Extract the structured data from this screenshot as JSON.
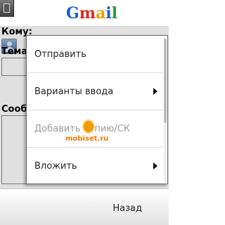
{
  "header": {
    "logo_letters": [
      "G",
      "m",
      "a",
      "i",
      "l"
    ],
    "back_icon": "exit-door-icon"
  },
  "compose": {
    "to_label": "Кому:",
    "subject_label": "Тема",
    "message_label": "Сообщ",
    "contact_icon": "contact-person-icon"
  },
  "menu": {
    "items": [
      {
        "label": "Отправить",
        "has_submenu": false,
        "enabled": true
      },
      {
        "label": "Варианты ввода",
        "has_submenu": true,
        "enabled": true
      },
      {
        "label": "Добавить копию/СК",
        "has_submenu": false,
        "enabled": false
      },
      {
        "label": "Вложить",
        "has_submenu": true,
        "enabled": true
      }
    ]
  },
  "watermark": {
    "text": "mobiset.ru"
  },
  "softkeys": {
    "right_label": "Назад"
  },
  "colors": {
    "logo_blue": "#1e5ec9",
    "logo_red": "#d62d20",
    "logo_yellow": "#e4a100",
    "logo_green": "#2c9a36",
    "disabled_text": "#9a9a9a",
    "watermark_orange": "#f07a00"
  }
}
